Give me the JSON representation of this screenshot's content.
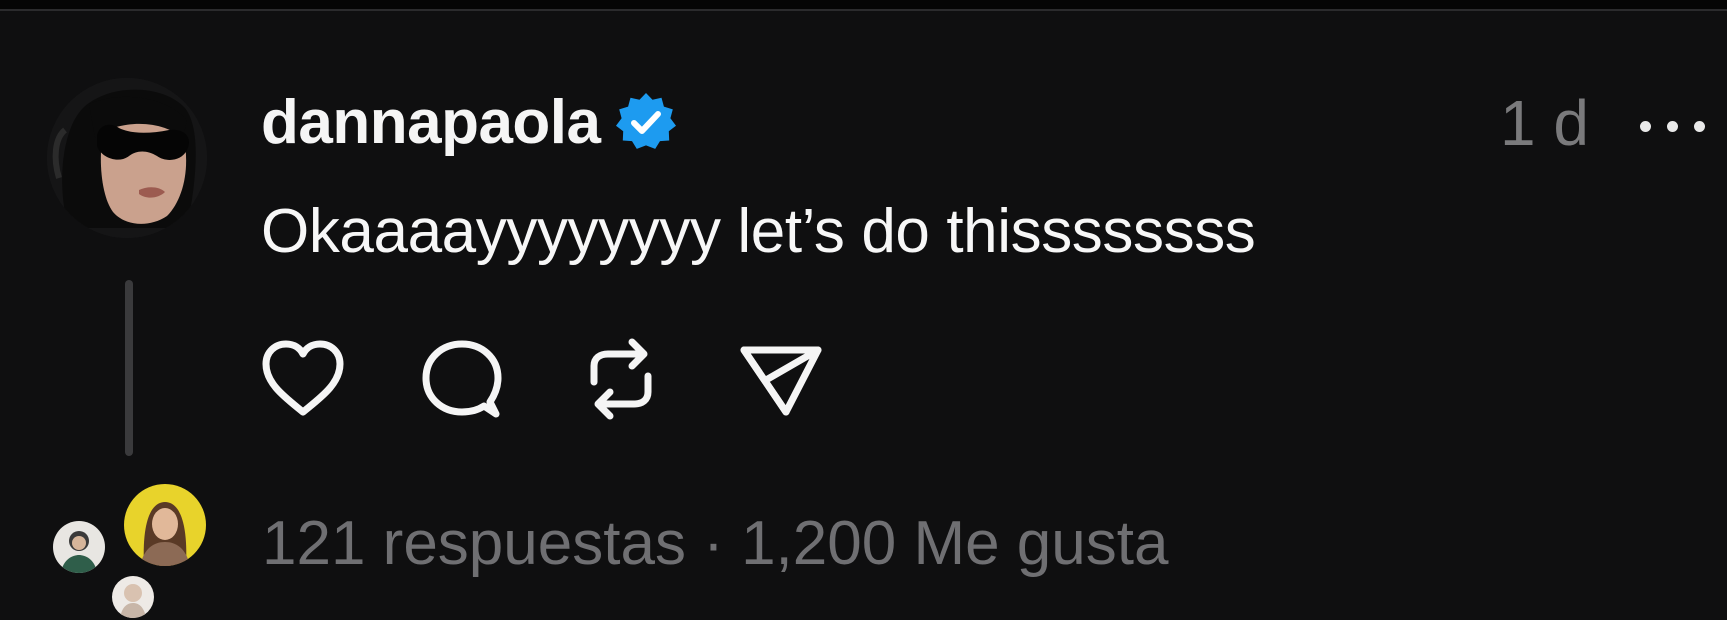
{
  "post": {
    "username": "dannapaola",
    "verified": true,
    "timestamp": "1 d",
    "text": "Okaaaayyyyyyyy let’s do thissssssss"
  },
  "stats": {
    "replies": "121 respuestas",
    "separator": " · ",
    "likes": "1,200 Me gusta"
  },
  "icons": {
    "verified": "verified-badge-icon",
    "more": "more-options-icon",
    "like": "heart-icon",
    "comment": "comment-bubble-icon",
    "repost": "repost-icon",
    "share": "send-icon"
  },
  "colors": {
    "background": "#0f0f10",
    "verified": "#1d9bf0",
    "text": "#f5f5f5",
    "muted": "#6f6f72"
  }
}
